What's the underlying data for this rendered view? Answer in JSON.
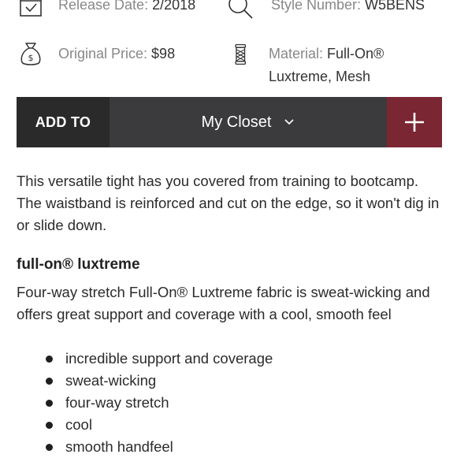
{
  "info": {
    "release_label": "Release Date: ",
    "release_value": "2/2018",
    "style_label": "Style Number: ",
    "style_value": "W5BENS",
    "price_label": "Original Price: ",
    "price_value": "$98",
    "material_label": "Material: ",
    "material_value_line1": "Full-On®",
    "material_value_line2": "Luxtreme, Mesh"
  },
  "add_bar": {
    "add_to_label": "ADD TO",
    "closet_label": "My Closet",
    "plus_icon": "plus-icon",
    "colors": {
      "add_to_bg": "#2a2a2a",
      "select_bg": "#3b3b3d",
      "plus_bg": "#7b2633"
    }
  },
  "description": "This versatile tight has you covered from training to bootcamp. The waistband is reinforced and cut on the edge, so it won't dig in or slide down.",
  "feature": {
    "heading": "full-on® luxtreme",
    "body": "Four-way stretch Full-On® Luxtreme fabric is sweat-wicking and offers great support and coverage with a cool, smooth feel",
    "bullets": [
      "incredible support and coverage",
      "sweat-wicking",
      "four-way stretch",
      "cool",
      "smooth handfeel"
    ]
  }
}
